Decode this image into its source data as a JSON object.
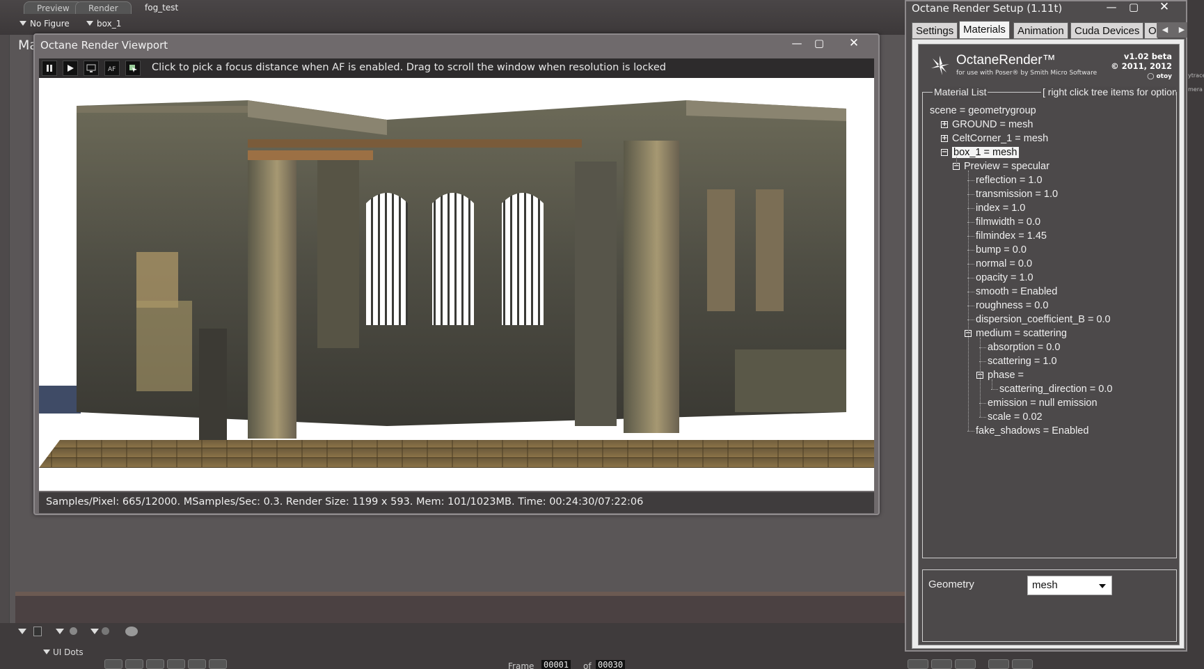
{
  "host": {
    "tabs": [
      "Preview",
      "Render"
    ],
    "scene_name": "fog_test",
    "figure_dropdown": "No Figure",
    "actor_dropdown": "box_1",
    "side_label": "Ma",
    "ui_dots_label": "UI Dots",
    "frame_label": "Frame",
    "frame_current": "00001",
    "frame_of": "of",
    "frame_total": "00030"
  },
  "viewport": {
    "title": "Octane Render Viewport",
    "hint": "Click to pick a focus distance when AF is enabled.  Drag to scroll the window when resolution is locked",
    "status": "Samples/Pixel: 665/12000. MSamples/Sec: 0.3. Render Size: 1199 x 593. Mem: 101/1023MB. Time: 00:24:30/07:22:06",
    "toolbar": [
      {
        "name": "pause-icon"
      },
      {
        "name": "play-icon"
      },
      {
        "name": "monitor-icon"
      },
      {
        "name": "autofocus-icon",
        "label": "AF"
      },
      {
        "name": "pick-icon"
      }
    ]
  },
  "setup": {
    "title": "Octane Render Setup (1.11t)",
    "tabs": [
      {
        "label": "Settings",
        "active": false
      },
      {
        "label": "Materials",
        "active": true
      },
      {
        "label": "Animation",
        "active": false
      },
      {
        "label": "Cuda Devices",
        "active": false
      },
      {
        "label": "O",
        "active": false
      }
    ],
    "logo": {
      "name": "OctaneRender™",
      "subtitle": "for use with Poser® by Smith Micro Software",
      "version": "v1.02 beta",
      "copyright": "© 2011, 2012",
      "otoy": "otoy"
    },
    "material_list_legend": "Material List",
    "material_list_hint": "[ right click tree items for options ]",
    "tree": [
      {
        "text": "scene = geometrygroup",
        "level": 0,
        "expander": null
      },
      {
        "text": "GROUND = mesh",
        "level": 1,
        "expander": "+"
      },
      {
        "text": "CeltCorner_1 = mesh",
        "level": 1,
        "expander": "+"
      },
      {
        "text": "box_1 = mesh",
        "level": 1,
        "expander": "-",
        "selected": true
      },
      {
        "text": "Preview = specular",
        "level": 2,
        "expander": "-"
      },
      {
        "text": "reflection = 1.0",
        "level": 3,
        "expander": null
      },
      {
        "text": "transmission = 1.0",
        "level": 3,
        "expander": null
      },
      {
        "text": "index = 1.0",
        "level": 3,
        "expander": null
      },
      {
        "text": "filmwidth = 0.0",
        "level": 3,
        "expander": null
      },
      {
        "text": "filmindex = 1.45",
        "level": 3,
        "expander": null
      },
      {
        "text": "bump = 0.0",
        "level": 3,
        "expander": null
      },
      {
        "text": "normal = 0.0",
        "level": 3,
        "expander": null
      },
      {
        "text": "opacity = 1.0",
        "level": 3,
        "expander": null
      },
      {
        "text": "smooth = Enabled",
        "level": 3,
        "expander": null
      },
      {
        "text": "roughness = 0.0",
        "level": 3,
        "expander": null
      },
      {
        "text": "dispersion_coefficient_B = 0.0",
        "level": 3,
        "expander": null
      },
      {
        "text": "medium = scattering",
        "level": 3,
        "expander": "-"
      },
      {
        "text": "absorption = 0.0",
        "level": 4,
        "expander": null
      },
      {
        "text": "scattering = 1.0",
        "level": 4,
        "expander": null
      },
      {
        "text": "phase =",
        "level": 4,
        "expander": "-"
      },
      {
        "text": "scattering_direction = 0.0",
        "level": 5,
        "expander": null
      },
      {
        "text": "emission = null emission",
        "level": 4,
        "expander": null
      },
      {
        "text": "scale = 0.02",
        "level": 4,
        "expander": null
      },
      {
        "text": "fake_shadows = Enabled",
        "level": 3,
        "expander": null
      }
    ],
    "geometry_label": "Geometry",
    "geometry_value": "mesh"
  },
  "right_edge": [
    "ytrace",
    "mera"
  ]
}
